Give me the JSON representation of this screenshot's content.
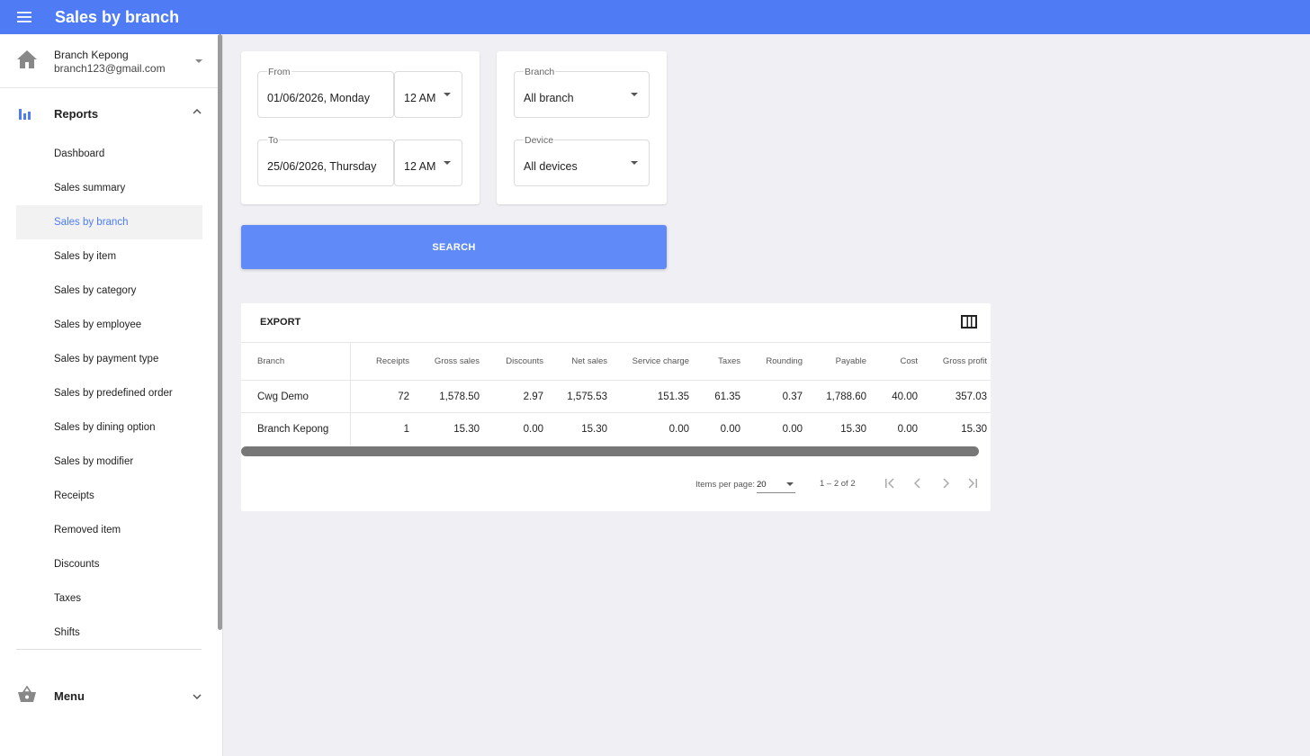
{
  "app": {
    "title": "Sales by branch",
    "colors": {
      "accent": "#4f7cf5",
      "button": "#5f8af7",
      "active_text": "#4f7cf5"
    }
  },
  "account": {
    "name": "Branch Kepong",
    "email": "branch123@gmail.com",
    "icon": "home-icon"
  },
  "sidebar": {
    "reports_section": {
      "label": "Reports",
      "icon": "bar-chart-icon",
      "expanded": true
    },
    "items": [
      {
        "label": "Dashboard"
      },
      {
        "label": "Sales summary"
      },
      {
        "label": "Sales by branch",
        "active": true
      },
      {
        "label": "Sales by item"
      },
      {
        "label": "Sales by category"
      },
      {
        "label": "Sales by employee"
      },
      {
        "label": "Sales by payment type"
      },
      {
        "label": "Sales by predefined order"
      },
      {
        "label": "Sales by dining option"
      },
      {
        "label": "Sales by modifier"
      },
      {
        "label": "Receipts"
      },
      {
        "label": "Removed item"
      },
      {
        "label": "Discounts"
      },
      {
        "label": "Taxes"
      },
      {
        "label": "Shifts"
      }
    ],
    "menu_section": {
      "label": "Menu",
      "icon": "basket-icon",
      "expanded": false
    }
  },
  "filters": {
    "from": {
      "label": "From",
      "date": "01/06/2026, Monday",
      "time": "12 AM"
    },
    "to": {
      "label": "To",
      "date": "25/06/2026, Thursday",
      "time": "12 AM"
    },
    "branch": {
      "label": "Branch",
      "value": "All branch"
    },
    "device": {
      "label": "Device",
      "value": "All devices"
    },
    "search_label": "SEARCH"
  },
  "table": {
    "export_label": "EXPORT",
    "columns": [
      "Branch",
      "Receipts",
      "Gross sales",
      "Discounts",
      "Net sales",
      "Service charge",
      "Taxes",
      "Rounding",
      "Payable",
      "Cost",
      "Gross profit"
    ],
    "rows": [
      [
        "Cwg Demo",
        "72",
        "1,578.50",
        "2.97",
        "1,575.53",
        "151.35",
        "61.35",
        "0.37",
        "1,788.60",
        "40.00",
        "357.03"
      ],
      [
        "Branch Kepong",
        "1",
        "15.30",
        "0.00",
        "15.30",
        "0.00",
        "0.00",
        "0.00",
        "15.30",
        "0.00",
        "15.30"
      ]
    ],
    "pagination": {
      "items_per_page_label": "Items per page:",
      "items_per_page": "20",
      "range": "1 – 2 of 2"
    }
  }
}
